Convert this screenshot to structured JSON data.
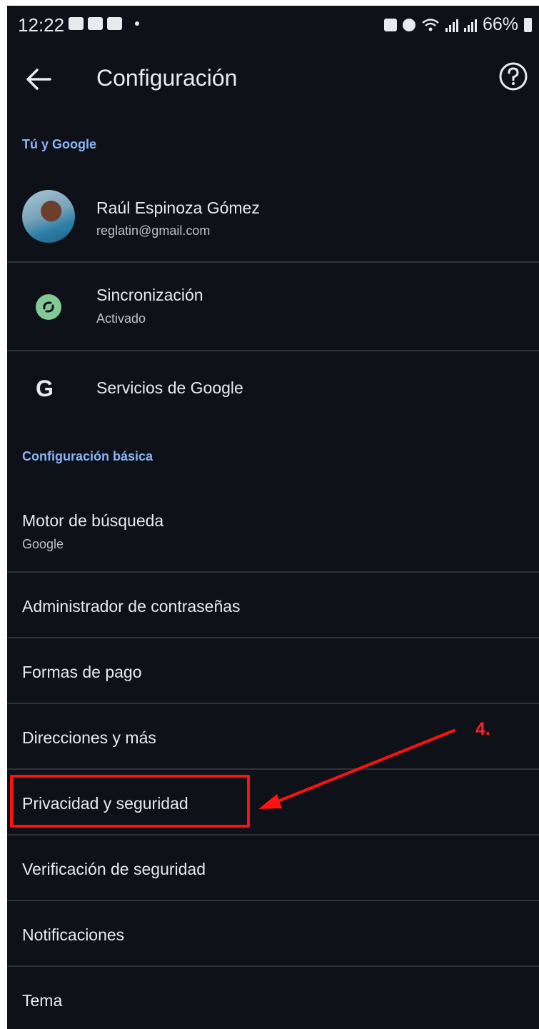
{
  "status_bar": {
    "time": "12:22",
    "battery": "66%",
    "icons": [
      "sms-icon",
      "sms-icon",
      "gallery-icon",
      "dot-icon",
      "battery-saver-icon",
      "alarm-icon",
      "wifi-icon",
      "signal-icon",
      "signal-icon",
      "battery-icon"
    ]
  },
  "app_bar": {
    "title": "Configuración",
    "back_icon": "arrow-back-icon",
    "help_icon": "help-circle-icon"
  },
  "sections": {
    "you_and_google": "Tú y Google",
    "basic_settings": "Configuración básica"
  },
  "account": {
    "name": "Raúl Espinoza Gómez",
    "email": "reglatin@gmail.com"
  },
  "sync": {
    "label": "Sincronización",
    "status": "Activado"
  },
  "google_services": {
    "label": "Servicios de Google",
    "icon_letter": "G"
  },
  "search_engine": {
    "label": "Motor de búsqueda",
    "value": "Google"
  },
  "items": {
    "passwords": "Administrador de contraseñas",
    "payment": "Formas de pago",
    "addresses": "Direcciones y más",
    "privacy": "Privacidad y seguridad",
    "safety_check": "Verificación de seguridad",
    "notifications": "Notificaciones",
    "theme": "Tema"
  },
  "annotation": {
    "label": "4.",
    "color": "#ff1111"
  },
  "colors": {
    "background": "#0e1117",
    "accent": "#8ab4f8",
    "sync_green": "#81c995"
  }
}
